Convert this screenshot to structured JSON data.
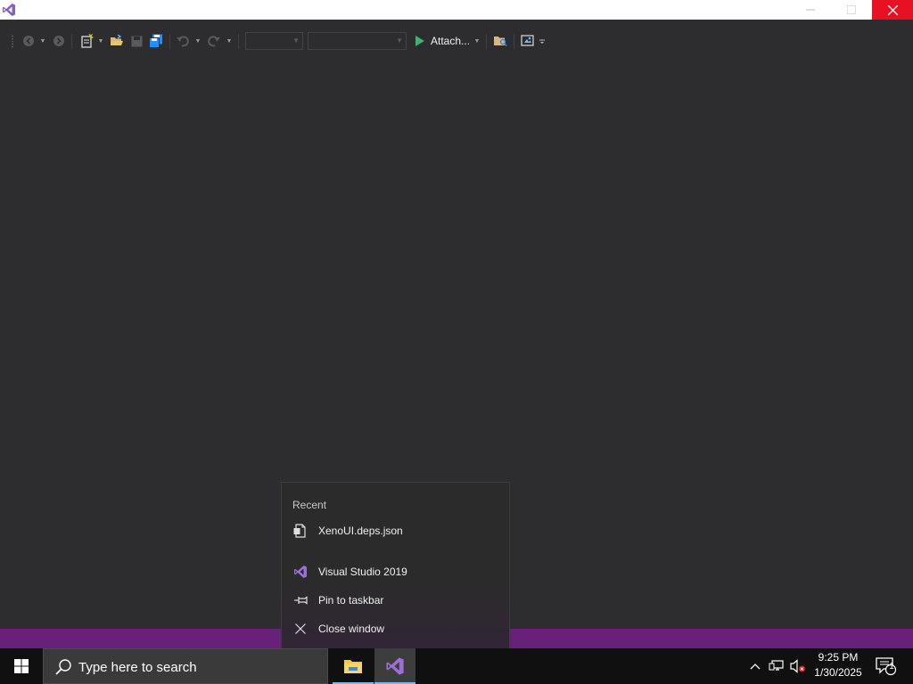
{
  "titlebar": {
    "app_icon": "visual-studio-icon",
    "buttons": [
      "minimize-icon",
      "maximize-icon",
      "close-icon"
    ]
  },
  "toolbar": {
    "attach_label": "Attach...",
    "icons": [
      "back-icon",
      "forward-icon",
      "new-project-icon",
      "open-folder-icon",
      "save-icon",
      "save-all-icon",
      "undo-icon",
      "redo-icon",
      "play-icon",
      "find-in-files-icon",
      "screenshot-icon"
    ]
  },
  "jumplist": {
    "header": "Recent",
    "recent_items": [
      {
        "label": "XenoUI.deps.json",
        "icon": "json-file-icon"
      }
    ],
    "tasks": [
      {
        "label": "Visual Studio 2019",
        "icon": "visual-studio-icon"
      },
      {
        "label": "Pin to taskbar",
        "icon": "pin-icon"
      },
      {
        "label": "Close window",
        "icon": "close-icon"
      }
    ]
  },
  "taskbar": {
    "search_placeholder": "Type here to search",
    "apps": [
      {
        "name": "File Explorer",
        "icon": "file-explorer-icon"
      },
      {
        "name": "Visual Studio",
        "icon": "visual-studio-icon"
      }
    ],
    "clock": {
      "time": "9:25 PM",
      "date": "1/30/2025"
    },
    "notification_count": "1"
  },
  "colors": {
    "status_bar": "#68217a",
    "editor_bg": "#2d2d30",
    "close_button": "#e81123",
    "vs_purple": "#865fc5"
  }
}
